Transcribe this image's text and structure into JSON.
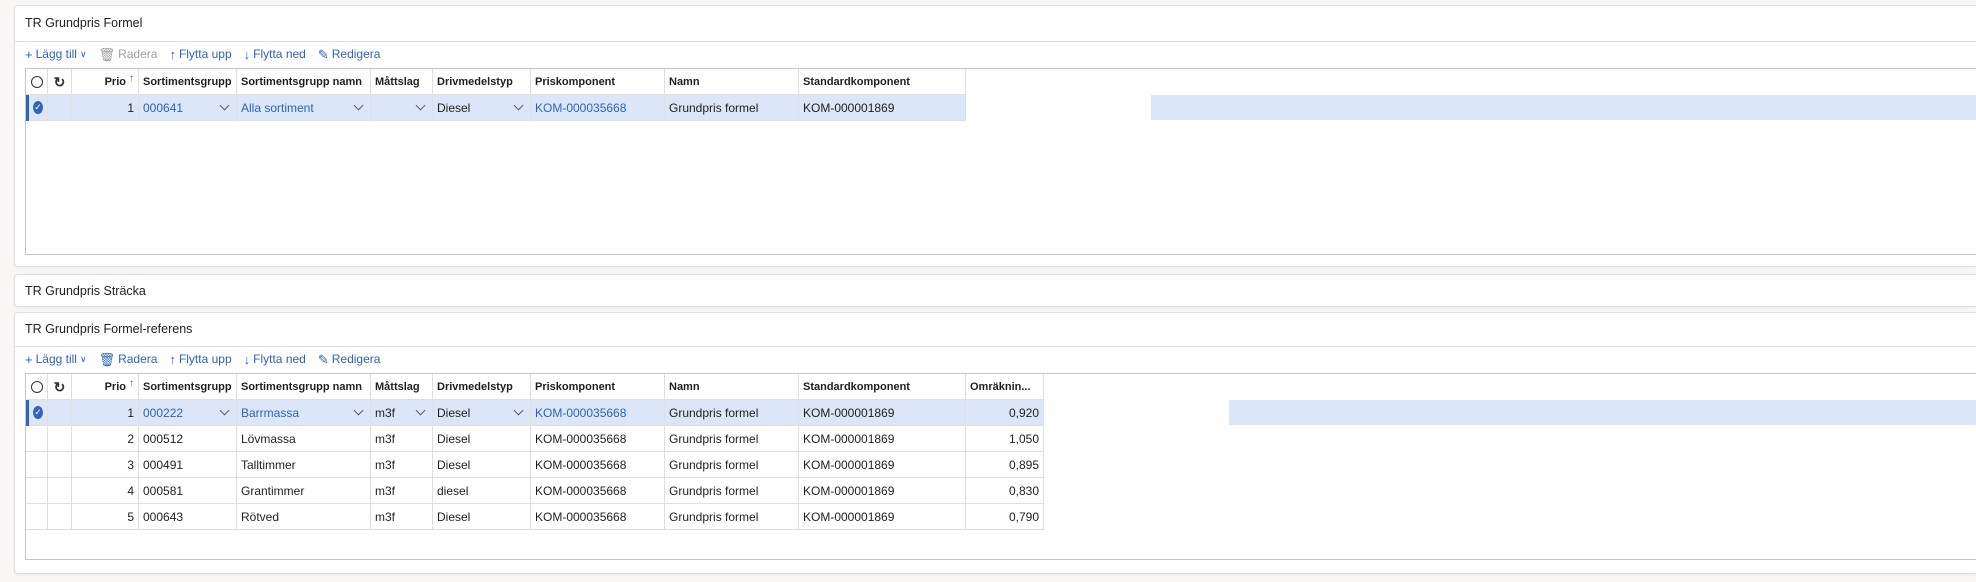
{
  "columns": {
    "prio": "Prio",
    "sortimentsgrupp": "Sortimentsgrupp",
    "sortimentsgrupp_namn": "Sortimentsgrupp namn",
    "mattslag": "Måttslag",
    "drivmedelstyp": "Drivmedelstyp",
    "priskomponent": "Priskomponent",
    "namn": "Namn",
    "standardkomponent": "Standardkomponent",
    "omrakning": "Omräknin..."
  },
  "toolbar": {
    "add": "Lägg till",
    "delete": "Radera",
    "move_up": "Flytta upp",
    "move_down": "Flytta ned",
    "edit": "Redigera"
  },
  "icons": {
    "add": "plus-icon",
    "delete": "trash-icon",
    "move_up": "arrow-up-icon",
    "move_down": "arrow-down-icon",
    "edit": "pencil-icon",
    "select_all": "radio-empty-icon",
    "refresh": "refresh-icon",
    "row_selected": "checkmark-circle-icon",
    "dropdown": "chevron-down-icon"
  },
  "colors": {
    "accent": "#2f64b8",
    "selected_row": "#dbe6f8"
  },
  "panel1": {
    "title": "TR Grundpris Formel",
    "rows": [
      {
        "prio": "1",
        "sortimentsgrupp": "000641",
        "sortimentsgrupp_namn": "Alla sortiment",
        "mattslag": "",
        "drivmedelstyp": "Diesel",
        "priskomponent": "KOM-000035668",
        "namn": "Grundpris formel",
        "standardkomponent": "KOM-000001869"
      }
    ]
  },
  "panel2": {
    "title": "TR Grundpris Sträcka"
  },
  "panel3": {
    "title": "TR Grundpris Formel-referens",
    "rows": [
      {
        "prio": "1",
        "sortimentsgrupp": "000222",
        "sortimentsgrupp_namn": "Barrmassa",
        "mattslag": "m3f",
        "drivmedelstyp": "Diesel",
        "priskomponent": "KOM-000035668",
        "namn": "Grundpris formel",
        "standardkomponent": "KOM-000001869",
        "omrakning": "0,920"
      },
      {
        "prio": "2",
        "sortimentsgrupp": "000512",
        "sortimentsgrupp_namn": "Lövmassa",
        "mattslag": "m3f",
        "drivmedelstyp": "Diesel",
        "priskomponent": "KOM-000035668",
        "namn": "Grundpris formel",
        "standardkomponent": "KOM-000001869",
        "omrakning": "1,050"
      },
      {
        "prio": "3",
        "sortimentsgrupp": "000491",
        "sortimentsgrupp_namn": "Talltimmer",
        "mattslag": "m3f",
        "drivmedelstyp": "Diesel",
        "priskomponent": "KOM-000035668",
        "namn": "Grundpris formel",
        "standardkomponent": "KOM-000001869",
        "omrakning": "0,895"
      },
      {
        "prio": "4",
        "sortimentsgrupp": "000581",
        "sortimentsgrupp_namn": "Grantimmer",
        "mattslag": "m3f",
        "drivmedelstyp": "diesel",
        "priskomponent": "KOM-000035668",
        "namn": "Grundpris formel",
        "standardkomponent": "KOM-000001869",
        "omrakning": "0,830"
      },
      {
        "prio": "5",
        "sortimentsgrupp": "000643",
        "sortimentsgrupp_namn": "Rötved",
        "mattslag": "m3f",
        "drivmedelstyp": "Diesel",
        "priskomponent": "KOM-000035668",
        "namn": "Grundpris formel",
        "standardkomponent": "KOM-000001869",
        "omrakning": "0,790"
      }
    ]
  }
}
